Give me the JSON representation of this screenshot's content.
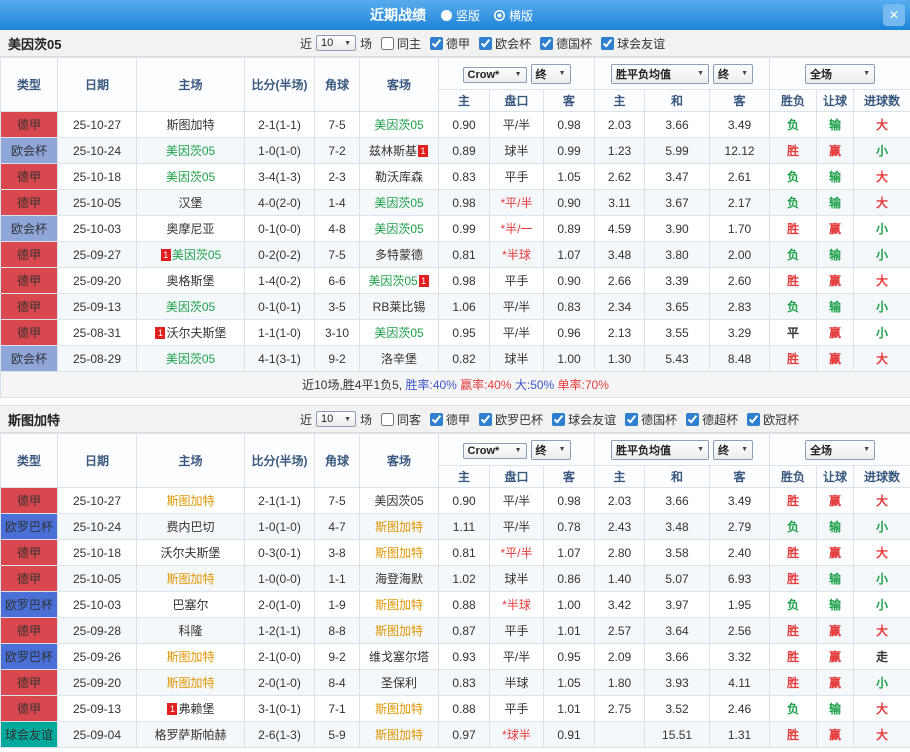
{
  "titlebar": {
    "title": "近期战绩",
    "options": [
      {
        "label": "竖版",
        "selected": false
      },
      {
        "label": "横版",
        "selected": true
      }
    ],
    "close_label": "✕"
  },
  "badge_text": "1",
  "table_header": {
    "main_cols": [
      "类型",
      "日期",
      "主场",
      "比分(半场)",
      "角球",
      "客场"
    ],
    "odds_select": "Crow*",
    "odds_final_select": "终",
    "avg_select": "胜平负均值",
    "avg_final_select": "终",
    "scope_select": "全场",
    "sub_cols": [
      "主",
      "盘口",
      "客",
      "主",
      "和",
      "客",
      "胜负",
      "让球",
      "进球数"
    ]
  },
  "league_colors": {
    "德甲": "#d9484e",
    "欧会杯": "#8ea6d8",
    "欧罗巴杯": "#4a6fd6",
    "球会友谊": "#00a99b"
  },
  "text_colors": {
    "plain": "#333333",
    "red": "#e53b3b",
    "green": "#1fa04a",
    "orange": "#e09600",
    "blue": "#3c57c8",
    "navy": "#2b4d7e"
  },
  "sections": [
    {
      "team": "美因茨05",
      "filter": {
        "near": "近",
        "count": "10",
        "games": "场",
        "checkboxes": [
          {
            "label": "同主",
            "checked": false
          },
          {
            "label": "德甲",
            "checked": true
          },
          {
            "label": "欧会杯",
            "checked": true
          },
          {
            "label": "德国杯",
            "checked": true
          },
          {
            "label": "球会友谊",
            "checked": true
          }
        ]
      },
      "rows": [
        {
          "league": "德甲",
          "date": "25-10-27",
          "home": {
            "text": "斯图加特",
            "color": "plain"
          },
          "score": "2-1(1-1)",
          "corners": "7-5",
          "away": {
            "text": "美因茨05",
            "color": "green"
          },
          "o1": "0.90",
          "hc": "平/半",
          "hcRed": false,
          "o2": "0.98",
          "a1": "2.03",
          "a2": "3.66",
          "a3": "3.49",
          "r": [
            "负",
            "green"
          ],
          "c": [
            "输",
            "green"
          ],
          "g": [
            "大",
            "red"
          ]
        },
        {
          "league": "欧会杯",
          "date": "25-10-24",
          "home": {
            "text": "美因茨05",
            "color": "green"
          },
          "score": "1-0(1-0)",
          "corners": "7-2",
          "away": {
            "text": "兹林斯基",
            "color": "plain",
            "badge": "after"
          },
          "o1": "0.89",
          "hc": "球半",
          "hcRed": false,
          "o2": "0.99",
          "a1": "1.23",
          "a2": "5.99",
          "a3": "12.12",
          "r": [
            "胜",
            "red"
          ],
          "c": [
            "赢",
            "red"
          ],
          "g": [
            "小",
            "green"
          ]
        },
        {
          "league": "德甲",
          "date": "25-10-18",
          "home": {
            "text": "美因茨05",
            "color": "green"
          },
          "score": "3-4(1-3)",
          "corners": "2-3",
          "away": {
            "text": "勒沃库森",
            "color": "plain"
          },
          "o1": "0.83",
          "hc": "平手",
          "hcRed": false,
          "o2": "1.05",
          "a1": "2.62",
          "a2": "3.47",
          "a3": "2.61",
          "r": [
            "负",
            "green"
          ],
          "c": [
            "输",
            "green"
          ],
          "g": [
            "大",
            "red"
          ]
        },
        {
          "league": "德甲",
          "date": "25-10-05",
          "home": {
            "text": "汉堡",
            "color": "plain"
          },
          "score": "4-0(2-0)",
          "corners": "1-4",
          "away": {
            "text": "美因茨05",
            "color": "green"
          },
          "o1": "0.98",
          "hc": "*平/半",
          "hcRed": true,
          "o2": "0.90",
          "a1": "3.11",
          "a2": "3.67",
          "a3": "2.17",
          "r": [
            "负",
            "green"
          ],
          "c": [
            "输",
            "green"
          ],
          "g": [
            "大",
            "red"
          ]
        },
        {
          "league": "欧会杯",
          "date": "25-10-03",
          "home": {
            "text": "奥摩尼亚",
            "color": "plain"
          },
          "score": "0-1(0-0)",
          "corners": "4-8",
          "away": {
            "text": "美因茨05",
            "color": "green"
          },
          "o1": "0.99",
          "hc": "*半/一",
          "hcRed": true,
          "o2": "0.89",
          "a1": "4.59",
          "a2": "3.90",
          "a3": "1.70",
          "r": [
            "胜",
            "red"
          ],
          "c": [
            "赢",
            "red"
          ],
          "g": [
            "小",
            "green"
          ]
        },
        {
          "league": "德甲",
          "date": "25-09-27",
          "home": {
            "text": "美因茨05",
            "color": "green",
            "badge": "before"
          },
          "score": "0-2(0-2)",
          "corners": "7-5",
          "away": {
            "text": "多特蒙德",
            "color": "plain"
          },
          "o1": "0.81",
          "hc": "*半球",
          "hcRed": true,
          "o2": "1.07",
          "a1": "3.48",
          "a2": "3.80",
          "a3": "2.00",
          "r": [
            "负",
            "green"
          ],
          "c": [
            "输",
            "green"
          ],
          "g": [
            "小",
            "green"
          ]
        },
        {
          "league": "德甲",
          "date": "25-09-20",
          "home": {
            "text": "奥格斯堡",
            "color": "plain"
          },
          "score": "1-4(0-2)",
          "corners": "6-6",
          "away": {
            "text": "美因茨05",
            "color": "green",
            "badge": "after"
          },
          "o1": "0.98",
          "hc": "平手",
          "hcRed": false,
          "o2": "0.90",
          "a1": "2.66",
          "a2": "3.39",
          "a3": "2.60",
          "r": [
            "胜",
            "red"
          ],
          "c": [
            "赢",
            "red"
          ],
          "g": [
            "大",
            "red"
          ]
        },
        {
          "league": "德甲",
          "date": "25-09-13",
          "home": {
            "text": "美因茨05",
            "color": "green"
          },
          "score": "0-1(0-1)",
          "corners": "3-5",
          "away": {
            "text": "RB莱比锡",
            "color": "plain"
          },
          "o1": "1.06",
          "hc": "平/半",
          "hcRed": false,
          "o2": "0.83",
          "a1": "2.34",
          "a2": "3.65",
          "a3": "2.83",
          "r": [
            "负",
            "green"
          ],
          "c": [
            "输",
            "green"
          ],
          "g": [
            "小",
            "green"
          ]
        },
        {
          "league": "德甲",
          "date": "25-08-31",
          "home": {
            "text": "沃尔夫斯堡",
            "color": "plain",
            "badge": "before"
          },
          "score": "1-1(1-0)",
          "corners": "3-10",
          "away": {
            "text": "美因茨05",
            "color": "green"
          },
          "o1": "0.95",
          "hc": "平/半",
          "hcRed": false,
          "o2": "0.96",
          "a1": "2.13",
          "a2": "3.55",
          "a3": "3.29",
          "r": [
            "平",
            "plain"
          ],
          "c": [
            "赢",
            "red"
          ],
          "g": [
            "小",
            "green"
          ]
        },
        {
          "league": "欧会杯",
          "date": "25-08-29",
          "home": {
            "text": "美因茨05",
            "color": "green"
          },
          "score": "4-1(3-1)",
          "corners": "9-2",
          "away": {
            "text": "洛辛堡",
            "color": "plain"
          },
          "o1": "0.82",
          "hc": "球半",
          "hcRed": false,
          "o2": "1.00",
          "a1": "1.30",
          "a2": "5.43",
          "a3": "8.48",
          "r": [
            "胜",
            "red"
          ],
          "c": [
            "赢",
            "red"
          ],
          "g": [
            "大",
            "red"
          ]
        }
      ],
      "summary": [
        {
          "text": "近10场,胜4平1负5, ",
          "color": "plain"
        },
        {
          "text": "胜率:40%",
          "color": "blue"
        },
        {
          "text": " 赢率:40%",
          "color": "red"
        },
        {
          "text": " 大:50%",
          "color": "blue"
        },
        {
          "text": " 单率:70%",
          "color": "red"
        }
      ]
    },
    {
      "team": "斯图加特",
      "filter": {
        "near": "近",
        "count": "10",
        "games": "场",
        "checkboxes": [
          {
            "label": "同客",
            "checked": false
          },
          {
            "label": "德甲",
            "checked": true
          },
          {
            "label": "欧罗巴杯",
            "checked": true
          },
          {
            "label": "球会友谊",
            "checked": true
          },
          {
            "label": "德国杯",
            "checked": true
          },
          {
            "label": "德超杯",
            "checked": true
          },
          {
            "label": "欧冠杯",
            "checked": true
          }
        ]
      },
      "rows": [
        {
          "league": "德甲",
          "date": "25-10-27",
          "home": {
            "text": "斯图加特",
            "color": "orange"
          },
          "score": "2-1(1-1)",
          "corners": "7-5",
          "away": {
            "text": "美因茨05",
            "color": "plain"
          },
          "o1": "0.90",
          "hc": "平/半",
          "hcRed": false,
          "o2": "0.98",
          "a1": "2.03",
          "a2": "3.66",
          "a3": "3.49",
          "r": [
            "胜",
            "red"
          ],
          "c": [
            "赢",
            "red"
          ],
          "g": [
            "大",
            "red"
          ]
        },
        {
          "league": "欧罗巴杯",
          "date": "25-10-24",
          "home": {
            "text": "费内巴切",
            "color": "plain"
          },
          "score": "1-0(1-0)",
          "corners": "4-7",
          "away": {
            "text": "斯图加特",
            "color": "orange"
          },
          "o1": "1.11",
          "hc": "平/半",
          "hcRed": false,
          "o2": "0.78",
          "a1": "2.43",
          "a2": "3.48",
          "a3": "2.79",
          "r": [
            "负",
            "green"
          ],
          "c": [
            "输",
            "green"
          ],
          "g": [
            "小",
            "green"
          ]
        },
        {
          "league": "德甲",
          "date": "25-10-18",
          "home": {
            "text": "沃尔夫斯堡",
            "color": "plain"
          },
          "score": "0-3(0-1)",
          "corners": "3-8",
          "away": {
            "text": "斯图加特",
            "color": "orange"
          },
          "o1": "0.81",
          "hc": "*平/半",
          "hcRed": true,
          "o2": "1.07",
          "a1": "2.80",
          "a2": "3.58",
          "a3": "2.40",
          "r": [
            "胜",
            "red"
          ],
          "c": [
            "赢",
            "red"
          ],
          "g": [
            "大",
            "red"
          ]
        },
        {
          "league": "德甲",
          "date": "25-10-05",
          "home": {
            "text": "斯图加特",
            "color": "orange"
          },
          "score": "1-0(0-0)",
          "corners": "1-1",
          "away": {
            "text": "海登海默",
            "color": "plain"
          },
          "o1": "1.02",
          "hc": "球半",
          "hcRed": false,
          "o2": "0.86",
          "a1": "1.40",
          "a2": "5.07",
          "a3": "6.93",
          "r": [
            "胜",
            "red"
          ],
          "c": [
            "输",
            "green"
          ],
          "g": [
            "小",
            "green"
          ]
        },
        {
          "league": "欧罗巴杯",
          "date": "25-10-03",
          "home": {
            "text": "巴塞尔",
            "color": "plain"
          },
          "score": "2-0(1-0)",
          "corners": "1-9",
          "away": {
            "text": "斯图加特",
            "color": "orange"
          },
          "o1": "0.88",
          "hc": "*半球",
          "hcRed": true,
          "o2": "1.00",
          "a1": "3.42",
          "a2": "3.97",
          "a3": "1.95",
          "r": [
            "负",
            "green"
          ],
          "c": [
            "输",
            "green"
          ],
          "g": [
            "小",
            "green"
          ]
        },
        {
          "league": "德甲",
          "date": "25-09-28",
          "home": {
            "text": "科隆",
            "color": "plain"
          },
          "score": "1-2(1-1)",
          "corners": "8-8",
          "away": {
            "text": "斯图加特",
            "color": "orange"
          },
          "o1": "0.87",
          "hc": "平手",
          "hcRed": false,
          "o2": "1.01",
          "a1": "2.57",
          "a2": "3.64",
          "a3": "2.56",
          "r": [
            "胜",
            "red"
          ],
          "c": [
            "赢",
            "red"
          ],
          "g": [
            "大",
            "red"
          ]
        },
        {
          "league": "欧罗巴杯",
          "date": "25-09-26",
          "home": {
            "text": "斯图加特",
            "color": "orange"
          },
          "score": "2-1(0-0)",
          "corners": "9-2",
          "away": {
            "text": "维戈塞尔塔",
            "color": "plain"
          },
          "o1": "0.93",
          "hc": "平/半",
          "hcRed": false,
          "o2": "0.95",
          "a1": "2.09",
          "a2": "3.66",
          "a3": "3.32",
          "r": [
            "胜",
            "red"
          ],
          "c": [
            "赢",
            "red"
          ],
          "g": [
            "走",
            "plain"
          ]
        },
        {
          "league": "德甲",
          "date": "25-09-20",
          "home": {
            "text": "斯图加特",
            "color": "orange"
          },
          "score": "2-0(1-0)",
          "corners": "8-4",
          "away": {
            "text": "圣保利",
            "color": "plain"
          },
          "o1": "0.83",
          "hc": "半球",
          "hcRed": false,
          "o2": "1.05",
          "a1": "1.80",
          "a2": "3.93",
          "a3": "4.11",
          "r": [
            "胜",
            "red"
          ],
          "c": [
            "赢",
            "red"
          ],
          "g": [
            "小",
            "green"
          ]
        },
        {
          "league": "德甲",
          "date": "25-09-13",
          "home": {
            "text": "弗赖堡",
            "color": "plain",
            "badge": "before"
          },
          "score": "3-1(0-1)",
          "corners": "7-1",
          "away": {
            "text": "斯图加特",
            "color": "orange"
          },
          "o1": "0.88",
          "hc": "平手",
          "hcRed": false,
          "o2": "1.01",
          "a1": "2.75",
          "a2": "3.52",
          "a3": "2.46",
          "r": [
            "负",
            "green"
          ],
          "c": [
            "输",
            "green"
          ],
          "g": [
            "大",
            "red"
          ]
        },
        {
          "league": "球会友谊",
          "date": "25-09-04",
          "home": {
            "text": "格罗萨斯帕赫",
            "color": "plain"
          },
          "score": "2-6(1-3)",
          "corners": "5-9",
          "away": {
            "text": "斯图加特",
            "color": "orange"
          },
          "o1": "0.97",
          "hc": "*球半",
          "hcRed": true,
          "o2": "0.91",
          "a1": "",
          "a2": "15.51",
          "a3": "1.31",
          "r": [
            "胜",
            "red"
          ],
          "c": [
            "赢",
            "red"
          ],
          "g": [
            "大",
            "red"
          ]
        }
      ],
      "summary": []
    }
  ]
}
